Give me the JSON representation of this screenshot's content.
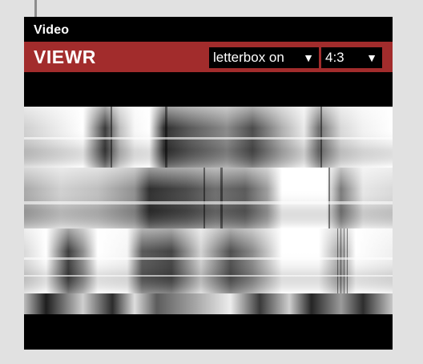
{
  "module": {
    "title": "Video",
    "name": "VIEWR",
    "letterbox_select": {
      "value": "letterbox on"
    },
    "aspect_select": {
      "value": "4:3"
    }
  },
  "colors": {
    "page_background": "#e1e1e1",
    "module_background": "#000000",
    "header_bar": "#a22c2c",
    "text": "#ffffff"
  },
  "icons": {
    "dropdown_arrow": "chevron-down-icon",
    "dropdown_arrow_glyph": "▼"
  }
}
